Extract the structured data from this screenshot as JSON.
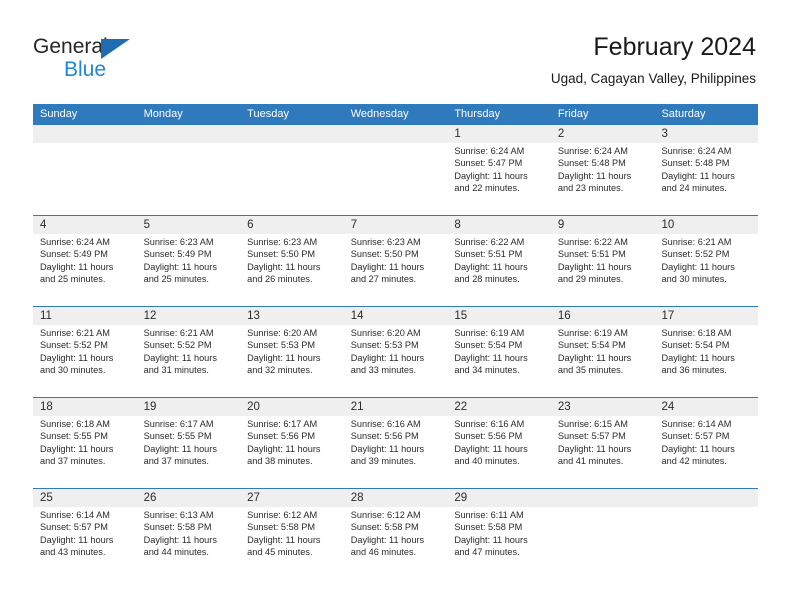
{
  "logo": {
    "word1": "General",
    "word2": "Blue",
    "triangle_color": "#1f6cb0",
    "word2_color": "#2187d4"
  },
  "header": {
    "title": "February 2024",
    "subtitle": "Ugad, Cagayan Valley, Philippines"
  },
  "theme": {
    "header_blue": "#2f79bd",
    "date_band_gray": "#efeff0",
    "text": "#2b2b2b"
  },
  "calendar": {
    "weekdays": [
      "Sunday",
      "Monday",
      "Tuesday",
      "Wednesday",
      "Thursday",
      "Friday",
      "Saturday"
    ],
    "weeks": [
      [
        {
          "day": "",
          "empty": true
        },
        {
          "day": "",
          "empty": true
        },
        {
          "day": "",
          "empty": true
        },
        {
          "day": "",
          "empty": true
        },
        {
          "day": "1",
          "sunrise": "Sunrise: 6:24 AM",
          "sunset": "Sunset: 5:47 PM",
          "daylight_1": "Daylight: 11 hours",
          "daylight_2": "and 22 minutes."
        },
        {
          "day": "2",
          "sunrise": "Sunrise: 6:24 AM",
          "sunset": "Sunset: 5:48 PM",
          "daylight_1": "Daylight: 11 hours",
          "daylight_2": "and 23 minutes."
        },
        {
          "day": "3",
          "sunrise": "Sunrise: 6:24 AM",
          "sunset": "Sunset: 5:48 PM",
          "daylight_1": "Daylight: 11 hours",
          "daylight_2": "and 24 minutes."
        }
      ],
      [
        {
          "day": "4",
          "sunrise": "Sunrise: 6:24 AM",
          "sunset": "Sunset: 5:49 PM",
          "daylight_1": "Daylight: 11 hours",
          "daylight_2": "and 25 minutes."
        },
        {
          "day": "5",
          "sunrise": "Sunrise: 6:23 AM",
          "sunset": "Sunset: 5:49 PM",
          "daylight_1": "Daylight: 11 hours",
          "daylight_2": "and 25 minutes."
        },
        {
          "day": "6",
          "sunrise": "Sunrise: 6:23 AM",
          "sunset": "Sunset: 5:50 PM",
          "daylight_1": "Daylight: 11 hours",
          "daylight_2": "and 26 minutes."
        },
        {
          "day": "7",
          "sunrise": "Sunrise: 6:23 AM",
          "sunset": "Sunset: 5:50 PM",
          "daylight_1": "Daylight: 11 hours",
          "daylight_2": "and 27 minutes."
        },
        {
          "day": "8",
          "sunrise": "Sunrise: 6:22 AM",
          "sunset": "Sunset: 5:51 PM",
          "daylight_1": "Daylight: 11 hours",
          "daylight_2": "and 28 minutes."
        },
        {
          "day": "9",
          "sunrise": "Sunrise: 6:22 AM",
          "sunset": "Sunset: 5:51 PM",
          "daylight_1": "Daylight: 11 hours",
          "daylight_2": "and 29 minutes."
        },
        {
          "day": "10",
          "sunrise": "Sunrise: 6:21 AM",
          "sunset": "Sunset: 5:52 PM",
          "daylight_1": "Daylight: 11 hours",
          "daylight_2": "and 30 minutes."
        }
      ],
      [
        {
          "day": "11",
          "sunrise": "Sunrise: 6:21 AM",
          "sunset": "Sunset: 5:52 PM",
          "daylight_1": "Daylight: 11 hours",
          "daylight_2": "and 30 minutes."
        },
        {
          "day": "12",
          "sunrise": "Sunrise: 6:21 AM",
          "sunset": "Sunset: 5:52 PM",
          "daylight_1": "Daylight: 11 hours",
          "daylight_2": "and 31 minutes."
        },
        {
          "day": "13",
          "sunrise": "Sunrise: 6:20 AM",
          "sunset": "Sunset: 5:53 PM",
          "daylight_1": "Daylight: 11 hours",
          "daylight_2": "and 32 minutes."
        },
        {
          "day": "14",
          "sunrise": "Sunrise: 6:20 AM",
          "sunset": "Sunset: 5:53 PM",
          "daylight_1": "Daylight: 11 hours",
          "daylight_2": "and 33 minutes."
        },
        {
          "day": "15",
          "sunrise": "Sunrise: 6:19 AM",
          "sunset": "Sunset: 5:54 PM",
          "daylight_1": "Daylight: 11 hours",
          "daylight_2": "and 34 minutes."
        },
        {
          "day": "16",
          "sunrise": "Sunrise: 6:19 AM",
          "sunset": "Sunset: 5:54 PM",
          "daylight_1": "Daylight: 11 hours",
          "daylight_2": "and 35 minutes."
        },
        {
          "day": "17",
          "sunrise": "Sunrise: 6:18 AM",
          "sunset": "Sunset: 5:54 PM",
          "daylight_1": "Daylight: 11 hours",
          "daylight_2": "and 36 minutes."
        }
      ],
      [
        {
          "day": "18",
          "sunrise": "Sunrise: 6:18 AM",
          "sunset": "Sunset: 5:55 PM",
          "daylight_1": "Daylight: 11 hours",
          "daylight_2": "and 37 minutes."
        },
        {
          "day": "19",
          "sunrise": "Sunrise: 6:17 AM",
          "sunset": "Sunset: 5:55 PM",
          "daylight_1": "Daylight: 11 hours",
          "daylight_2": "and 37 minutes."
        },
        {
          "day": "20",
          "sunrise": "Sunrise: 6:17 AM",
          "sunset": "Sunset: 5:56 PM",
          "daylight_1": "Daylight: 11 hours",
          "daylight_2": "and 38 minutes."
        },
        {
          "day": "21",
          "sunrise": "Sunrise: 6:16 AM",
          "sunset": "Sunset: 5:56 PM",
          "daylight_1": "Daylight: 11 hours",
          "daylight_2": "and 39 minutes."
        },
        {
          "day": "22",
          "sunrise": "Sunrise: 6:16 AM",
          "sunset": "Sunset: 5:56 PM",
          "daylight_1": "Daylight: 11 hours",
          "daylight_2": "and 40 minutes."
        },
        {
          "day": "23",
          "sunrise": "Sunrise: 6:15 AM",
          "sunset": "Sunset: 5:57 PM",
          "daylight_1": "Daylight: 11 hours",
          "daylight_2": "and 41 minutes."
        },
        {
          "day": "24",
          "sunrise": "Sunrise: 6:14 AM",
          "sunset": "Sunset: 5:57 PM",
          "daylight_1": "Daylight: 11 hours",
          "daylight_2": "and 42 minutes."
        }
      ],
      [
        {
          "day": "25",
          "sunrise": "Sunrise: 6:14 AM",
          "sunset": "Sunset: 5:57 PM",
          "daylight_1": "Daylight: 11 hours",
          "daylight_2": "and 43 minutes."
        },
        {
          "day": "26",
          "sunrise": "Sunrise: 6:13 AM",
          "sunset": "Sunset: 5:58 PM",
          "daylight_1": "Daylight: 11 hours",
          "daylight_2": "and 44 minutes."
        },
        {
          "day": "27",
          "sunrise": "Sunrise: 6:12 AM",
          "sunset": "Sunset: 5:58 PM",
          "daylight_1": "Daylight: 11 hours",
          "daylight_2": "and 45 minutes."
        },
        {
          "day": "28",
          "sunrise": "Sunrise: 6:12 AM",
          "sunset": "Sunset: 5:58 PM",
          "daylight_1": "Daylight: 11 hours",
          "daylight_2": "and 46 minutes."
        },
        {
          "day": "29",
          "sunrise": "Sunrise: 6:11 AM",
          "sunset": "Sunset: 5:58 PM",
          "daylight_1": "Daylight: 11 hours",
          "daylight_2": "and 47 minutes."
        },
        {
          "day": "",
          "empty": true
        },
        {
          "day": "",
          "empty": true
        }
      ]
    ]
  }
}
